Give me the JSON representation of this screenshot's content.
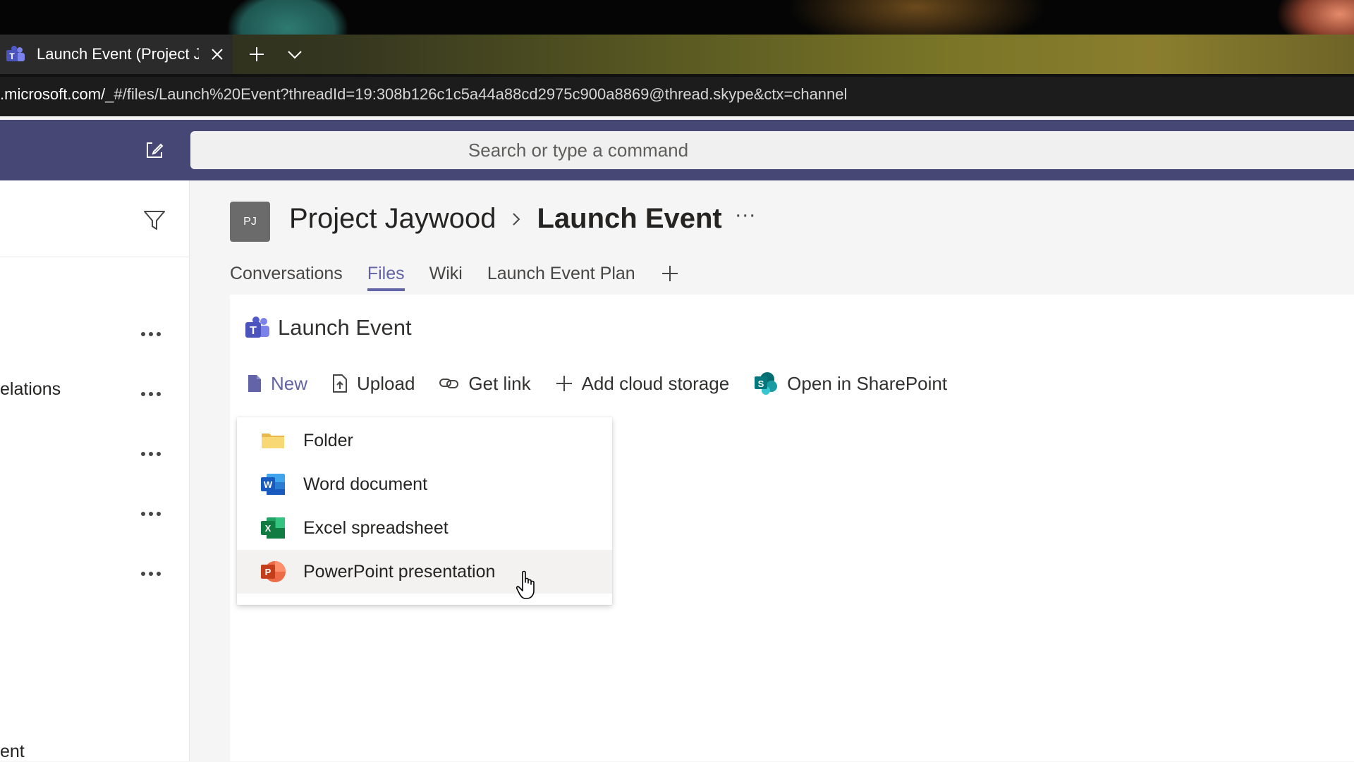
{
  "browser": {
    "tab_title": "Launch Event (Project Ja",
    "url_host": ".microsoft.com/",
    "url_path": "_#/files/Launch%20Event?threadId=19:308b126c1c5a44a88cd2975c900a8869@thread.skype&ctx=channel"
  },
  "header": {
    "search_placeholder": "Search or type a command"
  },
  "left_pane": {
    "visible_labels": [
      "elations",
      "ent"
    ]
  },
  "channel": {
    "team_initials": "PJ",
    "team_name": "Project Jaywood",
    "channel_name": "Launch Event",
    "more": "···",
    "tabs": [
      {
        "label": "Conversations",
        "active": false
      },
      {
        "label": "Files",
        "active": true
      },
      {
        "label": "Wiki",
        "active": false
      },
      {
        "label": "Launch Event Plan",
        "active": false
      }
    ]
  },
  "files": {
    "title": "Launch Event",
    "commands": {
      "new": "New",
      "upload": "Upload",
      "get_link": "Get link",
      "add_cloud_storage": "Add cloud storage",
      "open_in_sharepoint": "Open in SharePoint"
    },
    "new_menu": [
      {
        "label": "Folder",
        "icon": "folder-icon"
      },
      {
        "label": "Word document",
        "icon": "word-icon"
      },
      {
        "label": "Excel spreadsheet",
        "icon": "excel-icon"
      },
      {
        "label": "PowerPoint presentation",
        "icon": "powerpoint-icon",
        "hovered": true
      }
    ]
  },
  "colors": {
    "teams_purple": "#6264a7",
    "header_bg": "#464775",
    "word_blue": "#185abd",
    "excel_green": "#107c41",
    "powerpoint_orange": "#c43e1c",
    "folder_yellow": "#f8d775"
  }
}
